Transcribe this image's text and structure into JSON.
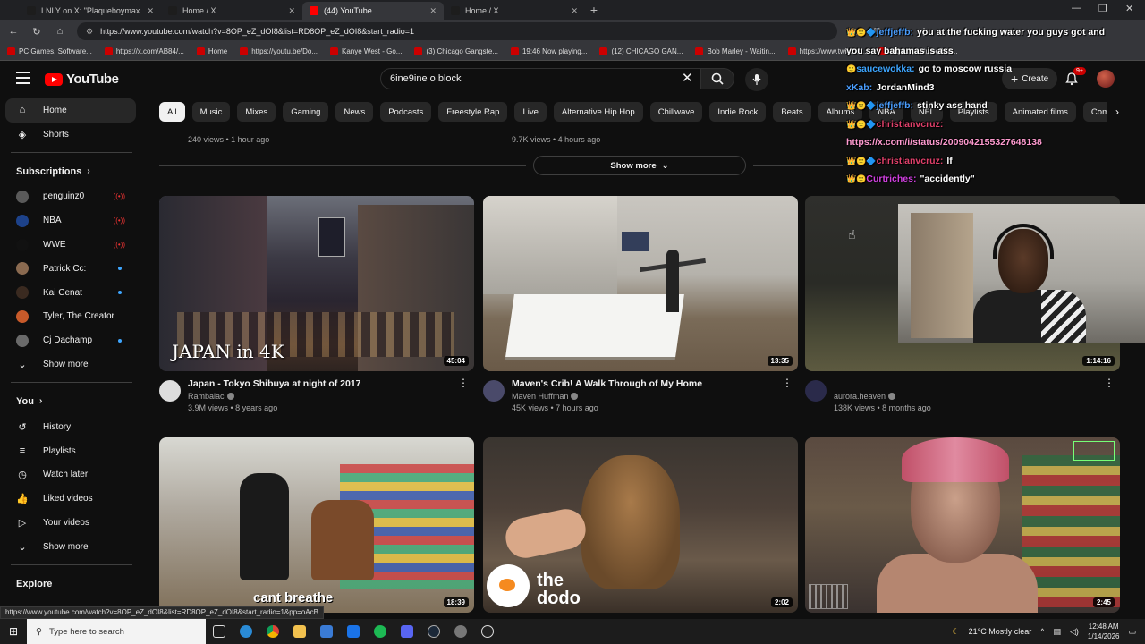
{
  "browser": {
    "tabs": [
      {
        "title": "LNLY on X: \"Plaqueboymax talks",
        "favicon_color": "#1d1d1d",
        "active": false
      },
      {
        "title": "Home / X",
        "favicon_color": "#1d1d1d",
        "active": false
      },
      {
        "title": "(44) YouTube",
        "favicon_color": "#ff0000",
        "active": true
      },
      {
        "title": "Home / X",
        "favicon_color": "#1d1d1d",
        "active": false
      }
    ],
    "url": "https://www.youtube.com/watch?v=8OP_eZ_dOI8&list=RD8OP_eZ_dOI8&start_radio=1",
    "bookmarks": [
      "PC Games, Software...",
      "https://x.com/AB84/...",
      "Home",
      "https://youtu.be/Do...",
      "Kanye West - Go...",
      "(3) Chicago Gangste...",
      "19:46 Now playing...",
      "(12) CHICAGO GAN...",
      "Bob Marley - Waitin...",
      "https://www.twitch.t...",
      "https://youtu.be/bIZ..."
    ]
  },
  "youtube": {
    "logo_text": "YouTube",
    "search_value": "6ine9ine o block",
    "create_label": "Create",
    "notification_count": "9+",
    "chips": [
      "All",
      "Music",
      "Mixes",
      "Gaming",
      "News",
      "Podcasts",
      "Freestyle Rap",
      "Live",
      "Alternative Hip Hop",
      "Chillwave",
      "Indie Rock",
      "Beats",
      "Albums",
      "NBA",
      "NFL",
      "Playlists",
      "Animated films",
      "Comedy"
    ],
    "sidebar": {
      "home": "Home",
      "shorts": "Shorts",
      "subscriptions_title": "Subscriptions",
      "subscriptions": [
        {
          "name": "penguinz0",
          "status": "live",
          "color": "#5a5a5a"
        },
        {
          "name": "NBA",
          "status": "live",
          "color": "#1d428a"
        },
        {
          "name": "WWE",
          "status": "live",
          "color": "#111111"
        },
        {
          "name": "Patrick Cc:",
          "status": "new",
          "color": "#8a6a50"
        },
        {
          "name": "Kai Cenat",
          "status": "new",
          "color": "#3a2a20"
        },
        {
          "name": "Tyler, The Creator",
          "status": "",
          "color": "#c85a2a"
        },
        {
          "name": "Cj Dachamp",
          "status": "new",
          "color": "#6a6a6a"
        }
      ],
      "show_more_1": "Show more",
      "you_title": "You",
      "you_items": [
        "History",
        "Playlists",
        "Watch later",
        "Liked videos",
        "Your videos"
      ],
      "show_more_2": "Show more",
      "explore_title": "Explore"
    },
    "previous_row": [
      {
        "stats": "240 views • 1 hour ago"
      },
      {
        "stats": "9.7K views • 4 hours ago"
      }
    ],
    "show_more_button": "Show more",
    "videos_row1": [
      {
        "title": "Japan - Tokyo Shibuya at night of 2017",
        "channel": "Rambalac",
        "stats": "3.9M views • 8 years ago",
        "duration": "45:04",
        "thumb_caption": "JAPAN in 4K",
        "avatar_color": "#dddddd"
      },
      {
        "title": "Maven's Crib! A Walk Through of My Home",
        "channel": "Maven Huffman",
        "stats": "45K views • 7 hours ago",
        "duration": "13:35",
        "thumb_caption": "",
        "avatar_color": "#4a4a6a"
      },
      {
        "title": "",
        "channel": "aurora.heaven",
        "stats": "138K views • 8 months ago",
        "duration": "1:14:16",
        "thumb_caption": "",
        "avatar_color": "#2a2a4a"
      }
    ],
    "videos_row2": [
      {
        "duration": "18:39",
        "thumb_caption": "cant breathe"
      },
      {
        "duration": "2:02",
        "thumb_caption": "the dodo"
      },
      {
        "duration": "2:45",
        "thumb_caption": ""
      }
    ]
  },
  "chat": [
    {
      "user": "jeffjeffb",
      "color": "#4a9eff",
      "badges": "👑🙂🔷",
      "msg": "you at the fucking water you guys got and"
    },
    {
      "user": "",
      "color": "#ffffff",
      "badges": "",
      "msg": "you say bahamas is ass"
    },
    {
      "user": "saucewokka",
      "color": "#3ea6ff",
      "badges": "🙂",
      "msg": "go to moscow russia"
    },
    {
      "user": "xKab",
      "color": "#4a9eff",
      "badges": "",
      "msg": "JordanMind3"
    },
    {
      "user": "jeffjeffb",
      "color": "#4a9eff",
      "badges": "👑🙂🔷",
      "msg": "stinky ass hand"
    },
    {
      "user": "christianvcruz",
      "color": "#e0406a",
      "badges": "👑🙂🔷",
      "msg": ""
    },
    {
      "user": "",
      "color": "#ff9bd0",
      "badges": "",
      "msg": "https://x.com/i/status/2009042155327648138"
    },
    {
      "user": "christianvcruz",
      "color": "#e0406a",
      "badges": "👑🙂🔷",
      "msg": "lf"
    },
    {
      "user": "Curtriches",
      "color": "#d040e0",
      "badges": "👑🙂",
      "msg": "\"accidently\""
    }
  ],
  "status_url": "https://www.youtube.com/watch?v=8OP_eZ_dOI8&list=RD8OP_eZ_dOI8&start_radio=1&pp=oAcB",
  "taskbar": {
    "search_placeholder": "Type here to search",
    "weather": "21°C  Mostly clear",
    "time": "12:48 AM",
    "date": "1/14/2026"
  }
}
